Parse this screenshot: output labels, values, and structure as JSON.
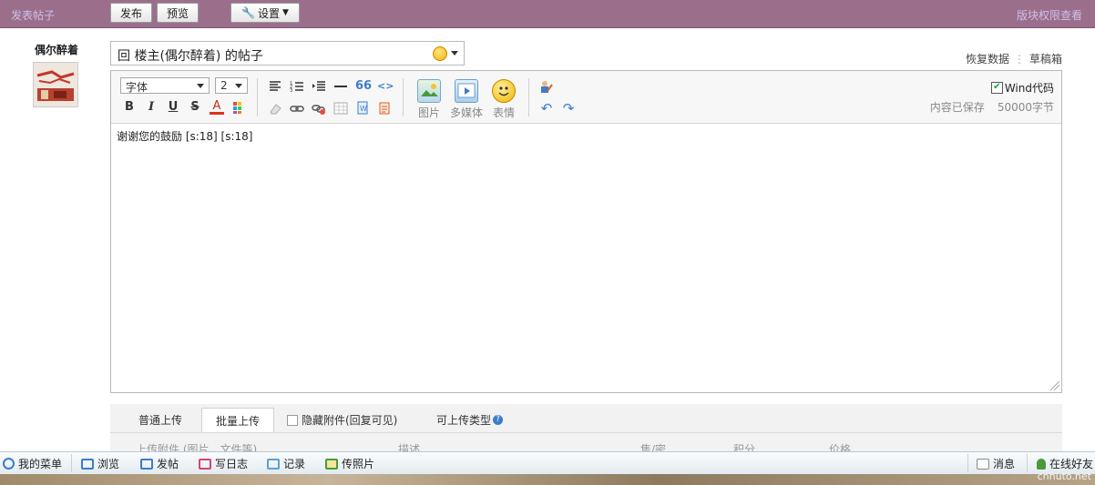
{
  "topbar": {
    "title": "发表帖子",
    "publish_label": "发布",
    "preview_label": "预览",
    "settings_label": "设置",
    "permissions_label": "版块权限查看"
  },
  "user": {
    "name": "偶尔醉着"
  },
  "subject": {
    "value": "回 楼主(偶尔醉着) 的帖子"
  },
  "links": {
    "restore": "恢复数据",
    "separator": "⋮",
    "drafts": "草稿箱"
  },
  "editor": {
    "font_label": "字体",
    "size_label": "2",
    "image_label": "图片",
    "media_label": "多媒体",
    "emoji_label": "表情",
    "wind_code_label": "Wind代码",
    "wind_code_checked": true,
    "saved_status": "内容已保存",
    "char_limit": "50000字节",
    "content": "谢谢您的鼓励 [s:18]  [s:18]"
  },
  "upload": {
    "tabs": [
      "普通上传",
      "批量上传"
    ],
    "active_tab": 1,
    "hidden_attachment_label": "隐藏附件(回复可见)",
    "allowed_types_label": "可上传类型",
    "columns": [
      "上传附件 (图片、文件等)",
      "描述",
      "售/密",
      "积分",
      "价格"
    ]
  },
  "taskbar": {
    "items": [
      "我的菜单",
      "浏览",
      "发帖",
      "写日志",
      "记录",
      "传照片"
    ],
    "messages": "消息",
    "online_friends": "在线好友"
  },
  "watermark": "cnhuto.net",
  "colors": {
    "topbar_bg": "#9b6f8c",
    "link_muted": "#cfc0e8",
    "taskbar_bg": "#e3ebf0"
  }
}
